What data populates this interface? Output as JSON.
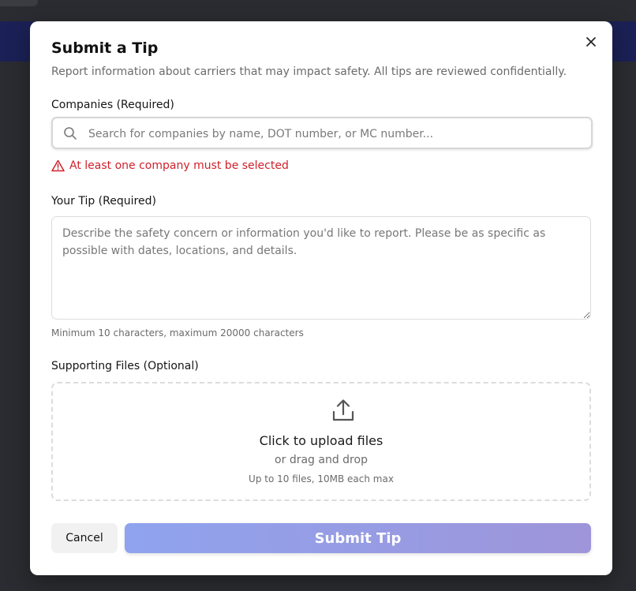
{
  "modal": {
    "title": "Submit a Tip",
    "subtitle": "Report information about carriers that may impact safety. All tips are reviewed confidentially.",
    "close_icon": "close-icon"
  },
  "companies": {
    "label": "Companies (Required)",
    "placeholder": "Search for companies by name, DOT number, or MC number...",
    "value": "",
    "error": "At least one company must be selected",
    "error_color": "#d0202b"
  },
  "tip": {
    "label": "Your Tip (Required)",
    "placeholder": "Describe the safety concern or information you'd like to report. Please be as specific as possible with dates, locations, and details.",
    "value": "",
    "hint": "Minimum 10 characters, maximum 20000 characters"
  },
  "files": {
    "label": "Supporting Files (Optional)",
    "upload_main": "Click to upload files",
    "upload_sub": "or drag and drop",
    "upload_limit": "Up to 10 files, 10MB each max"
  },
  "actions": {
    "cancel_label": "Cancel",
    "submit_label": "Submit Tip"
  },
  "colors": {
    "accent_start": "#8fa3ee",
    "accent_end": "#9e95da",
    "backdrop": "#2b2c31"
  }
}
